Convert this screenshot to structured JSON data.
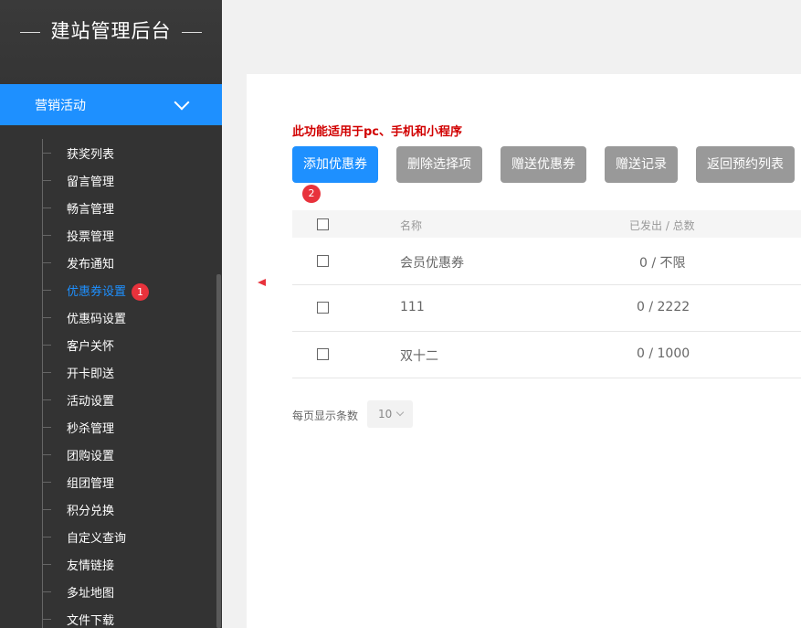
{
  "sidebar": {
    "brand": "建站管理后台",
    "active_menu": "营销活动",
    "items": [
      {
        "label": "获奖列表"
      },
      {
        "label": "留言管理"
      },
      {
        "label": "畅言管理"
      },
      {
        "label": "投票管理"
      },
      {
        "label": "发布通知"
      },
      {
        "label": "优惠券设置",
        "badge": "1"
      },
      {
        "label": "优惠码设置"
      },
      {
        "label": "客户关怀"
      },
      {
        "label": "开卡即送"
      },
      {
        "label": "活动设置"
      },
      {
        "label": "秒杀管理"
      },
      {
        "label": "团购设置"
      },
      {
        "label": "组团管理"
      },
      {
        "label": "积分兑换"
      },
      {
        "label": "自定义查询"
      },
      {
        "label": "友情链接"
      },
      {
        "label": "多址地图"
      },
      {
        "label": "文件下载"
      }
    ]
  },
  "main": {
    "notice": "此功能适用于pc、手机和小程序",
    "buttons": {
      "add": "添加优惠券",
      "delete": "删除选择项",
      "gift": "赠送优惠券",
      "gift_log": "赠送记录",
      "back": "返回预约列表"
    },
    "add_badge": "2",
    "table": {
      "headers": {
        "name": "名称",
        "issued": "已发出 / 总数"
      },
      "rows": [
        {
          "name": "会员优惠券",
          "issued": "0 / 不限"
        },
        {
          "name": "111",
          "issued": "0 / 2222"
        },
        {
          "name": "双十二",
          "issued": "0 / 1000"
        }
      ]
    },
    "pager": {
      "label": "每页显示条数",
      "per_page": "10"
    }
  },
  "colors": {
    "accent": "#1e90ff",
    "sidebar": "#333333",
    "badge": "#e8323c",
    "notice": "#d10000",
    "gray_button": "#999999"
  }
}
